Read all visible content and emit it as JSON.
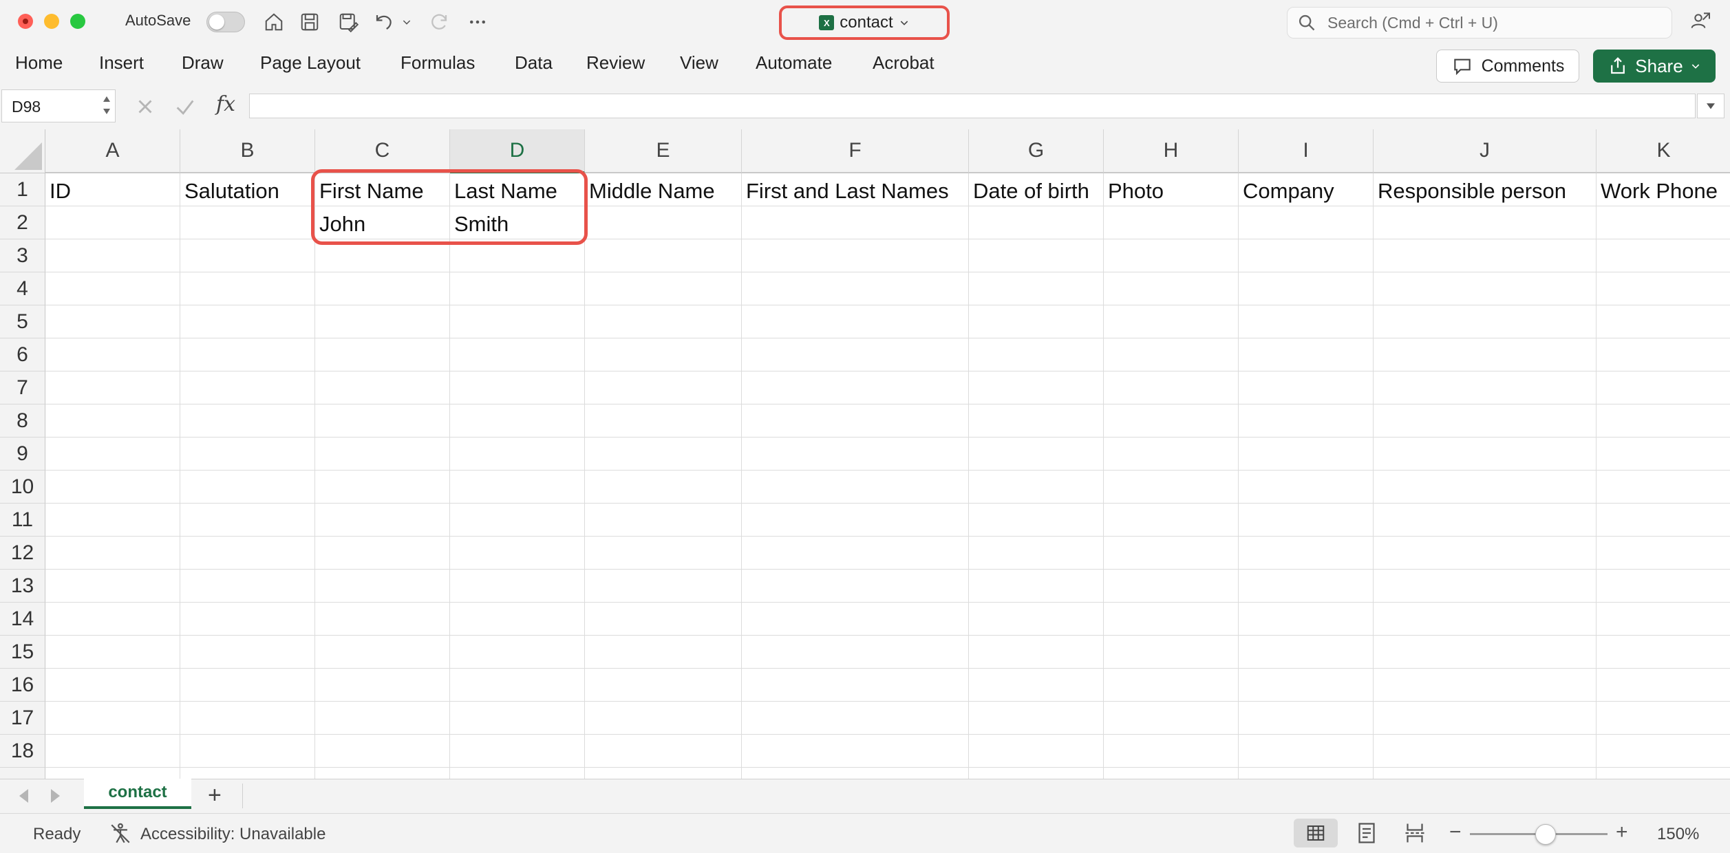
{
  "titlebar": {
    "autosave_label": "AutoSave",
    "document_title": "contact",
    "file_badge": "X",
    "search_placeholder": "Search (Cmd + Ctrl + U)"
  },
  "ribbon": {
    "tabs": [
      "Home",
      "Insert",
      "Draw",
      "Page Layout",
      "Formulas",
      "Data",
      "Review",
      "View",
      "Automate",
      "Acrobat"
    ],
    "comments_label": "Comments",
    "share_label": "Share"
  },
  "formula_bar": {
    "name_box": "D98",
    "fx_label": "fx",
    "formula": ""
  },
  "grid": {
    "columns": [
      "A",
      "B",
      "C",
      "D",
      "E",
      "F",
      "G",
      "H",
      "I",
      "J",
      "K"
    ],
    "selected_column": "D",
    "row_numbers": [
      "1",
      "2",
      "3",
      "4",
      "5",
      "6",
      "7",
      "8",
      "9",
      "10",
      "11",
      "12",
      "13",
      "14",
      "15",
      "16",
      "17",
      "18"
    ],
    "rows": [
      [
        "ID",
        "Salutation",
        "First Name",
        "Last Name",
        "Middle Name",
        "First and Last Names",
        "Date of birth",
        "Photo",
        "Company",
        "Responsible person",
        "Work Phone"
      ],
      [
        "",
        "",
        "John",
        "Smith",
        "",
        "",
        "",
        "",
        "",
        "",
        ""
      ]
    ]
  },
  "sheets": {
    "tabs": [
      "contact"
    ],
    "active": "contact",
    "add_label": "+"
  },
  "status": {
    "ready": "Ready",
    "accessibility": "Accessibility: Unavailable",
    "zoom": "150%",
    "zoom_fraction": 0.55
  },
  "colors": {
    "accent": "#1e7145",
    "highlight": "#e8524a"
  }
}
